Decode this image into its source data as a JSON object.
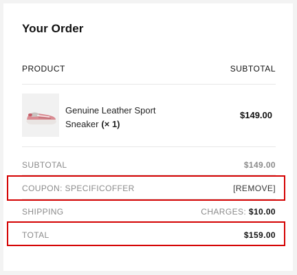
{
  "order": {
    "title": "Your Order",
    "product_header": "PRODUCT",
    "subtotal_header": "SUBTOTAL",
    "item": {
      "name": "Genuine Leather Sport Sneaker",
      "qty": "(× 1)",
      "price": "$149.00",
      "image_icon": "sneaker-image"
    },
    "subtotal_label": "SUBTOTAL",
    "subtotal_value": "$149.00",
    "coupon_label": "COUPON: SPECIFICOFFER",
    "coupon_remove": "[REMOVE]",
    "shipping_label": "SHIPPING",
    "shipping_charges_label": "CHARGES:",
    "shipping_value": "$10.00",
    "total_label": "TOTAL",
    "total_value": "$159.00"
  },
  "colors": {
    "highlight": "#d40000",
    "muted_text": "#8a8a8a",
    "divider": "#e6e6e6"
  }
}
